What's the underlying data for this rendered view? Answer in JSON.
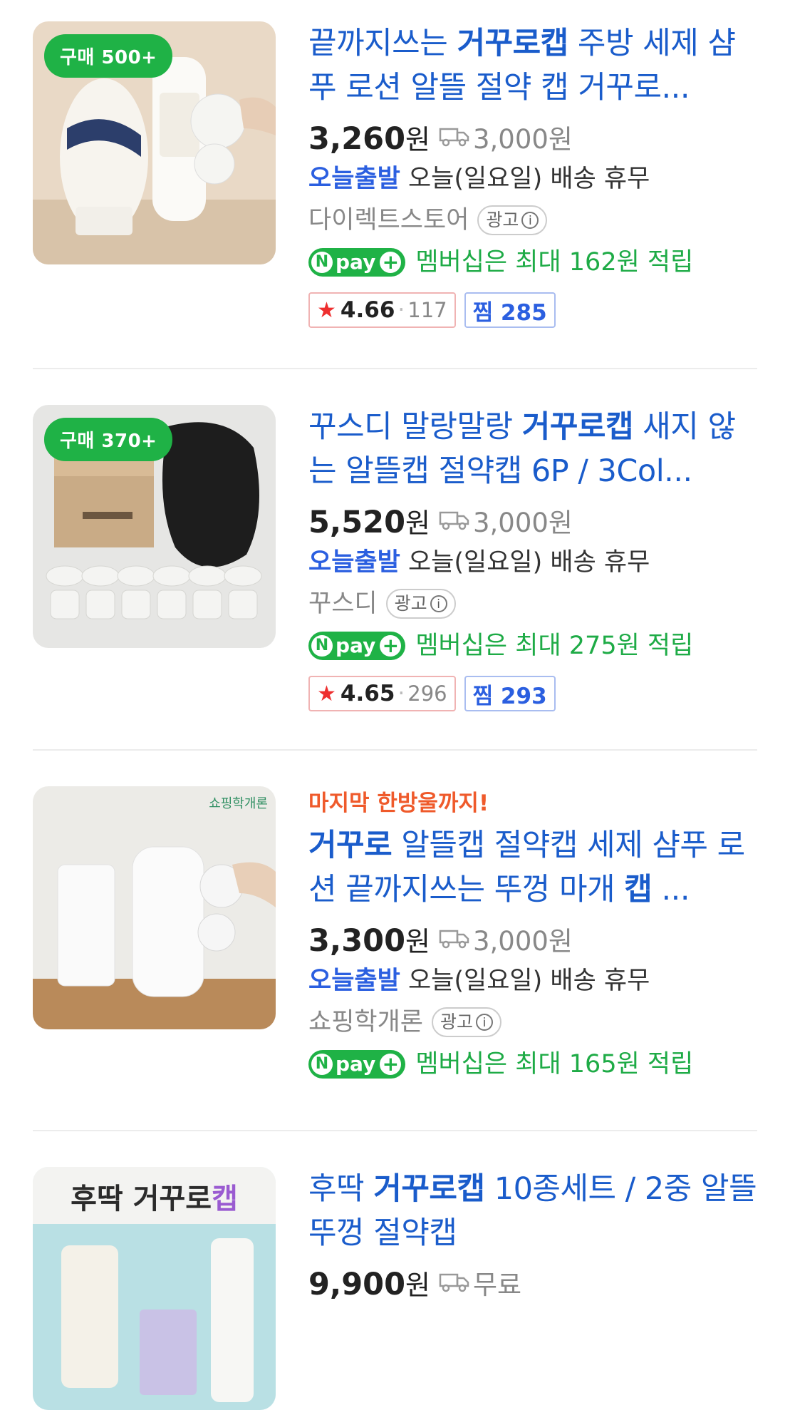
{
  "products": [
    {
      "badge": "구매 500+",
      "title_parts": [
        "끝까지쓰는 ",
        "거꾸로캡",
        " 주방 세제 샴푸 로션 알뜰 절약 캡 거꾸로..."
      ],
      "promo": "",
      "price": "3,260",
      "won": "원",
      "shipping": "3,000원",
      "today_tag": "오늘출발",
      "today_text": " 오늘(일요일) 배송 휴무",
      "seller": "다이렉트스토어",
      "ad_label": "광고",
      "npay_label": "pay",
      "npay_text": "멤버십은 최대 162원 적립",
      "rating": "4.66",
      "review_count": "117",
      "zzim": "찜 285"
    },
    {
      "badge": "구매 370+",
      "title_parts": [
        "꾸스디 말랑말랑 ",
        "거꾸로캡",
        " 새지 않는 알뜰캡 절약캡 6P / 3Col..."
      ],
      "promo": "",
      "price": "5,520",
      "won": "원",
      "shipping": "3,000원",
      "today_tag": "오늘출발",
      "today_text": " 오늘(일요일) 배송 휴무",
      "seller": "꾸스디",
      "ad_label": "광고",
      "npay_label": "pay",
      "npay_text": "멤버십은 최대 275원 적립",
      "rating": "4.65",
      "review_count": "296",
      "zzim": "찜 293"
    },
    {
      "badge": "",
      "title_parts": [
        "",
        "거꾸로",
        " 알뜰캡 절약캡 세제 샴푸 로션 끝까지쓰는 뚜껑 마개 ",
        "캡",
        " ..."
      ],
      "promo": "마지막 한방울까지!",
      "price": "3,300",
      "won": "원",
      "shipping": "3,000원",
      "today_tag": "오늘출발",
      "today_text": " 오늘(일요일) 배송 휴무",
      "seller": "쇼핑학개론",
      "ad_label": "광고",
      "npay_label": "pay",
      "npay_text": "멤버십은 최대 165원 적립",
      "rating": "",
      "review_count": "",
      "zzim": ""
    },
    {
      "badge": "",
      "thumb_text_a": "후딱 거꾸로",
      "thumb_text_b": "캡",
      "title_parts": [
        "후딱 ",
        "거꾸로캡",
        " 10종세트 / 2중 알뜰뚜껑 절약캡"
      ],
      "promo": "",
      "price": "9,900",
      "won": "원",
      "shipping": "무료"
    }
  ],
  "colors": {
    "title_blue": "#1a5ccb",
    "badge_green": "#1fb246",
    "today_blue": "#2b5fe0",
    "promo_orange": "#ef5a2b"
  }
}
